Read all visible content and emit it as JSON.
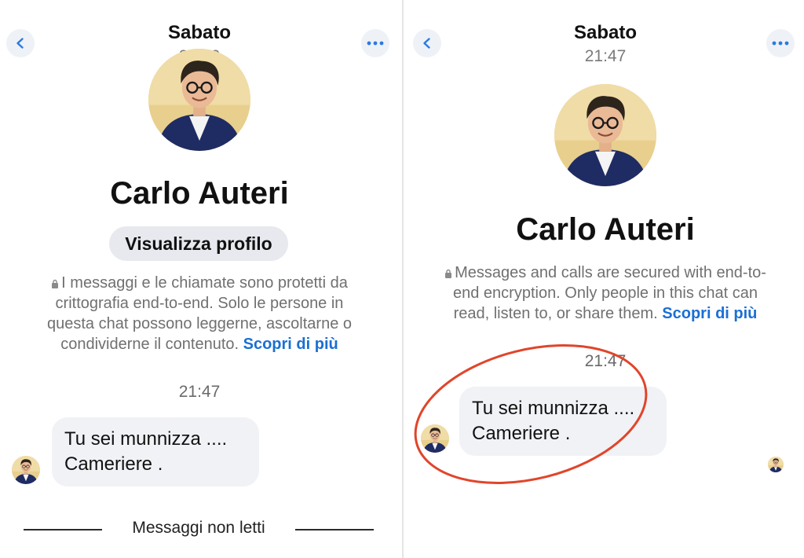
{
  "left": {
    "header": {
      "day": "Sabato",
      "time": "21:50"
    },
    "contact": {
      "name": "Carlo Auteri",
      "profile_button": "Visualizza profilo"
    },
    "encryption": {
      "lines": [
        "I messaggi e le chiamate sono protetti da",
        "crittografia end-to-end. Solo le persone in",
        "questa chat possono leggerne, ascoltarne o",
        "condividerne il contenuto."
      ],
      "link": "Scopri di più"
    },
    "timestamp": "21:47",
    "message": {
      "line1": "Tu sei munnizza ....",
      "line2": "Cameriere ."
    },
    "unread_divider": "Messaggi non letti"
  },
  "right": {
    "header": {
      "day": "Sabato",
      "time": "21:47"
    },
    "contact": {
      "name": "Carlo Auteri"
    },
    "encryption": {
      "lines": [
        "Messages and calls are secured with end-to-",
        "end encryption. Only people in this chat can",
        "read, listen to, or share them."
      ],
      "link": "Scopri di più"
    },
    "timestamp": "21:47",
    "message": {
      "line1": "Tu sei munnizza ....",
      "line2": "Cameriere ."
    }
  },
  "icons": {
    "back": "chevron-left-icon",
    "more": "more-horizontal-icon",
    "lock": "lock-icon"
  },
  "colors": {
    "link": "#1a6fd4",
    "annotation_circle": "#e0452b",
    "bubble": "#f0f2f6",
    "icon_button": "#eef1f6"
  }
}
